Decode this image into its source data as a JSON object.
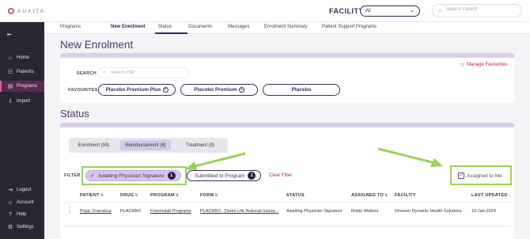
{
  "app": {
    "logo_text": "AUXITA"
  },
  "header": {
    "facility_label": "FACILITY",
    "facility_selected": "All",
    "search_placeholder": "Search Patient"
  },
  "sidebar": {
    "items": [
      {
        "label": "Home",
        "icon": "home-icon"
      },
      {
        "label": "Patients",
        "icon": "patients-icon"
      },
      {
        "label": "Programs",
        "icon": "programs-icon",
        "active": true
      },
      {
        "label": "Import",
        "icon": "import-icon"
      },
      {
        "label": "Logout",
        "icon": "logout-icon"
      },
      {
        "label": "Account",
        "icon": "account-icon"
      },
      {
        "label": "Help",
        "icon": "help-icon"
      },
      {
        "label": "Settings",
        "icon": "settings-icon"
      }
    ]
  },
  "tabs": [
    "Programs",
    "New Enrolment",
    "Status",
    "Documents",
    "Messages",
    "Enrolment Summary",
    "Patient Support Programs"
  ],
  "page": {
    "title": "New Enrolment",
    "status_title": "Status"
  },
  "enrolment": {
    "manage_favourites": "Manage Favourites",
    "search_label": "SEARCH",
    "search_placeholder": "Search PSP",
    "favourites_label": "FAVOURITES",
    "favourites": [
      "Placebo Premium Plus",
      "Placebo Premium",
      "Placebo"
    ]
  },
  "status": {
    "segments": [
      "Enrolment (59)",
      "Reimbursement (8)",
      "Treatment (0)"
    ],
    "filter_label": "FILTER",
    "filters": [
      {
        "label": "Awaiting Physician Signature",
        "count": "1"
      },
      {
        "label": "Submitted to Program",
        "count": "1"
      }
    ],
    "clear_filter": "Clear Filter",
    "assigned_to_me": "Assigned to Me",
    "columns": [
      "PATIENT",
      "DRUG",
      "PROGRAM",
      "FORM",
      "STATUS",
      "ASSIGNED TO",
      "FACILITY",
      "LAST UPDATED"
    ],
    "rows": [
      {
        "patient": "Pope, Fransisca",
        "drug": "PLACEBO",
        "program": "Freemulab Programs",
        "form": "PLACEBO - Demo Life National Insura...",
        "status": "Awaiting Physician Signature",
        "assigned_to": "Robin Walters",
        "facility": "Dinesen Dynamic Health Solutions",
        "last_updated": "10-Jan-2024"
      }
    ]
  },
  "colors": {
    "accent": "#3b2a5a",
    "highlight": "#9bd15a",
    "link_red": "#c0204a",
    "sidebar_bg": "#2a2630"
  }
}
